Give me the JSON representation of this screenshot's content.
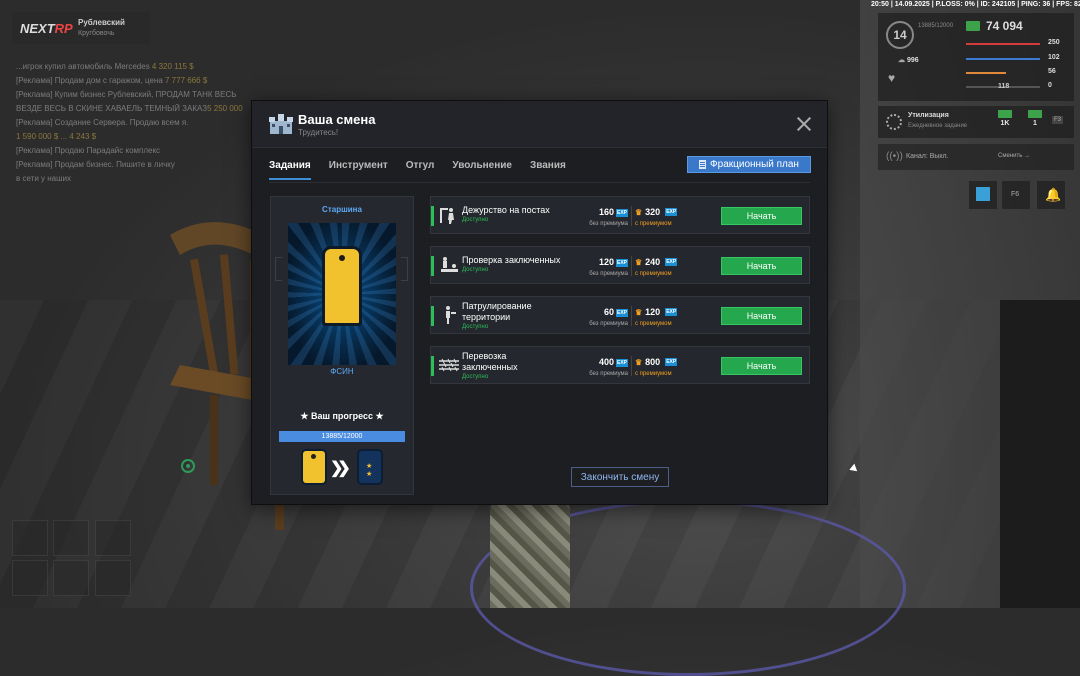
{
  "topbar": "20:50 | 14.09.2025 | P.LOSS: 0% | ID: 242105 | PING: 36 | FPS: 82",
  "logo": {
    "brand_a": "NEXT",
    "brand_b": "RP",
    "server_name": "Рублевский",
    "server_sub": "Кругбовочь"
  },
  "chat": [
    {
      "text": "...игрок купил автомобиль Mercedes ",
      "amount": "4 320 115 $"
    },
    {
      "text": "[Реклама] Продам дом с гаражом, цена ",
      "amount": "7 777 666 $"
    },
    {
      "text": "[Реклама] Купим бизнес Рублевский, ПРОДАМ ТАНК ВЕСЬ",
      "amount": ""
    },
    {
      "text": "ВЕЗДЕ ВЕСЬ В СКИНЕ ХАВАЕЛЬ ТЕМНЫЙ ЗАКАЗ",
      "amount": "5 250 000"
    },
    {
      "text": "[Реклама] Создание Сервера. Продаю всем я.",
      "amount": ""
    },
    {
      "text": "",
      "amount": "1 590 000 $   ... 4 243 $"
    },
    {
      "text": "[Реклама] Продаю Парадайс комплекс",
      "amount": ""
    },
    {
      "text": "[Реклама] Продам бизнес. Пишите в личку",
      "amount": ""
    },
    {
      "text": "в сети у наших",
      "amount": ""
    }
  ],
  "hud": {
    "level": "14",
    "exp_faint": "13885/12000",
    "money": "74 094",
    "donate": "996",
    "stats": {
      "health": "250",
      "armor": "102",
      "hunger": "56",
      "thirst": "0"
    },
    "weapon_ammo": "118",
    "colors": {
      "health": "#d33b3b",
      "armor": "#3b7bd3",
      "hunger": "#e0893a",
      "thirst": "#888888"
    }
  },
  "utilization": {
    "title": "Утилизация",
    "subtitle": "Ежедневное задание",
    "reward_1": "1K",
    "reward_2": "1",
    "key": "F3"
  },
  "channel": {
    "label": "Канал: Выкл.",
    "switch": "Сменить →"
  },
  "modal": {
    "title": "Ваша смена",
    "subtitle": "Трудитесь!",
    "tabs": [
      "Задания",
      "Инструмент",
      "Отгул",
      "Увольнение",
      "Звания"
    ],
    "active_tab": 0,
    "plan_button": "Фракционный план",
    "rank": {
      "name": "Старшина",
      "faction": "ФСИН",
      "progress_label": "★ Ваш прогресс ★",
      "progress_text": "13885/12000",
      "progress_fraction": 1.0,
      "next_stars": "★\n★"
    },
    "tasks": [
      {
        "name": "Дежурство на постах",
        "status": "Доступно",
        "exp_basic": "160",
        "exp_premium": "320",
        "icon": "guard-post-icon"
      },
      {
        "name": "Проверка заключенных",
        "status": "Доступно",
        "exp_basic": "120",
        "exp_premium": "240",
        "icon": "prisoner-check-icon"
      },
      {
        "name": "Патрулирование территории",
        "status": "Доступно",
        "exp_basic": "60",
        "exp_premium": "120",
        "icon": "patrol-icon"
      },
      {
        "name": "Перевозка заключенных",
        "status": "Доступно",
        "exp_basic": "400",
        "exp_premium": "800",
        "icon": "barbed-wire-icon"
      }
    ],
    "exp_tag": "EXP",
    "basic_label": "без премиума",
    "premium_label": "с премиумом",
    "start_label": "Начать",
    "end_button": "Закончить смену",
    "colors": {
      "accent_green": "#25a84d",
      "tab_underline": "#3d8fd8",
      "plan_blue": "#3a78c9",
      "premium_orange": "#f0a020"
    }
  }
}
